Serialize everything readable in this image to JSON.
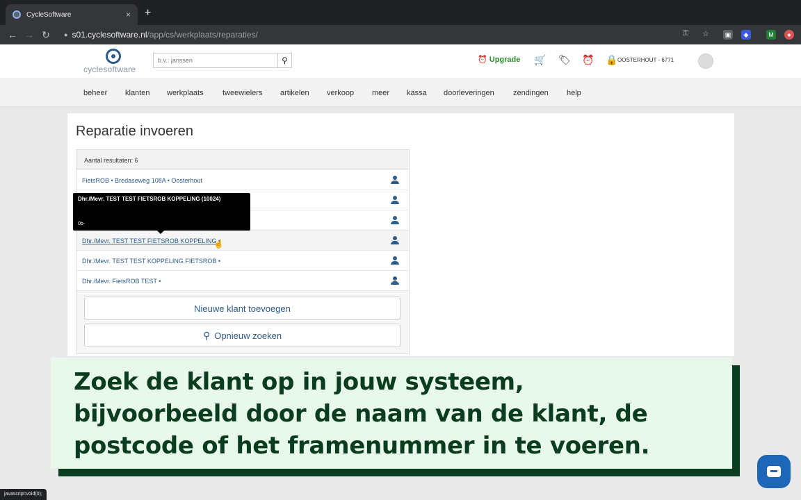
{
  "browser": {
    "tab_title": "CycleSoftware",
    "new_tab": "+",
    "tab_close": "×",
    "url_domain": "s01.cyclesoftware.nl",
    "url_path": "/app/cs/werkplaats/reparaties/",
    "status_url": "javascript:void(0);"
  },
  "header": {
    "logo_text": "cyclesoftware",
    "search_placeholder": "b.v.: janssen",
    "upgrade_label": "Upgrade",
    "store_label": "OOSTERHOUT - 6771"
  },
  "nav": {
    "items": [
      "beheer",
      "klanten",
      "werkplaats",
      "tweewielers",
      "artikelen",
      "verkoop",
      "meer",
      "kassa",
      "doorleveringen",
      "zendingen",
      "help"
    ]
  },
  "page": {
    "title": "Reparatie invoeren",
    "results_count": "Aantal resultaten: 6",
    "rows": [
      "FietsROB • Bredaseweg 108A • Oosterhout",
      "",
      "",
      "Dhr./Mevr. TEST TEST FIETSROB KOPPELING •",
      "Dhr./Mevr. TEST TEST KOPPELING FIETSROB •",
      "Dhr./Mevr. FietsROB TEST •"
    ],
    "tooltip_title": "Dhr./Mevr. TEST TEST FIETSROB KOPPELING (10024)",
    "tooltip_sub": "0b-",
    "new_customer_button": "Nieuwe klant toevoegen",
    "search_again_button": "Opnieuw zoeken"
  },
  "caption": {
    "lines": [
      "Zoek de klant op in jouw systeem,",
      "bijvoorbeeld door de naam van de klant, de",
      "postcode of het framenummer in te voeren."
    ]
  }
}
